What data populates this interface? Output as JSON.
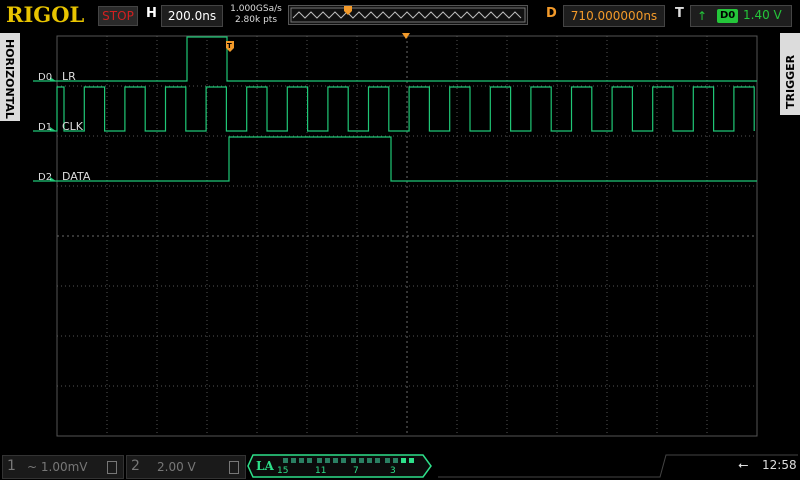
{
  "header": {
    "brand": "RIGOL",
    "run_state": "STOP",
    "timebase_label": "H",
    "timebase_value": "200.0ns",
    "sample_rate": "1.000GSa/s",
    "memory_depth": "2.80k pts",
    "delay_label": "D",
    "delay_value": "710.000000ns",
    "trigger_label": "T",
    "trigger_source": "D0",
    "trigger_level": "1.40 V",
    "trigger_edge_icon": "rising-edge-icon"
  },
  "side_tabs": {
    "left": "HORIZONTAL",
    "right": "TRIGGER"
  },
  "channels": [
    {
      "id": "D0",
      "name": "LR"
    },
    {
      "id": "D1",
      "name": "CLK"
    },
    {
      "id": "D2",
      "name": "DATA"
    }
  ],
  "trace_color": "#1fc776",
  "grid_color": "#555555",
  "bottom": {
    "ch1_number": "1",
    "ch1_scale": "~ 1.00mV",
    "ch2_number": "2",
    "ch2_scale": "2.00 V",
    "la_tag": "LA",
    "la_numbers": [
      "15",
      "11",
      "7",
      "3"
    ],
    "usb_icon": "usb-icon",
    "time": "12:58"
  }
}
